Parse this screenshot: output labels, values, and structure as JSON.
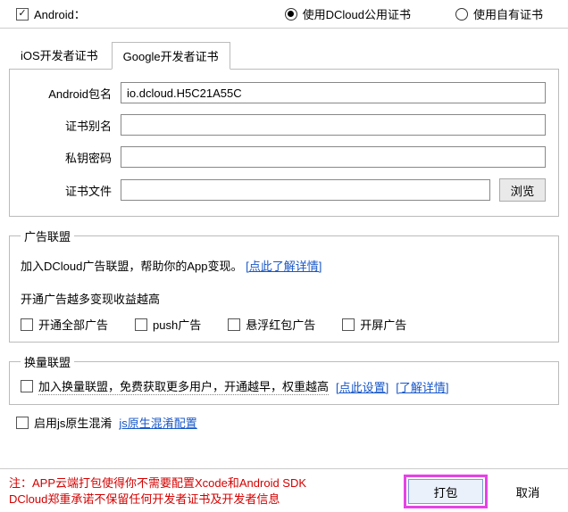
{
  "top": {
    "android_label": "Android：",
    "android_checked": true,
    "cert_public": "使用DCloud公用证书",
    "cert_own": "使用自有证书",
    "cert_selected": "public"
  },
  "tabs": {
    "ios": "iOS开发者证书",
    "google": "Google开发者证书",
    "active": "google"
  },
  "fields": {
    "pkg_label": "Android包名",
    "pkg_value": "io.dcloud.H5C21A55C",
    "alias_label": "证书别名",
    "alias_value": "",
    "pwd_label": "私钥密码",
    "pwd_value": "",
    "cert_label": "证书文件",
    "cert_value": "",
    "browse_btn": "浏览"
  },
  "ads": {
    "title": "广告联盟",
    "intro": "加入DCloud广告联盟，帮助你的App变现。",
    "details_link": "[点此了解详情]",
    "subline": "开通广告越多变现收益越高",
    "opt_all": "开通全部广告",
    "opt_push": "push广告",
    "opt_float": "悬浮红包广告",
    "opt_splash": "开屏广告"
  },
  "exchange": {
    "title": "换量联盟",
    "text": "加入换量联盟，免费获取更多用户，开通越早，权重越高",
    "set_link": "[点此设置]",
    "detail_link": "[了解详情]",
    "checked": false
  },
  "native": {
    "label": "启用js原生混淆",
    "link": "js原生混淆配置",
    "checked": false
  },
  "footer": {
    "note_l1": "注：APP云端打包使得你不需要配置Xcode和Android SDK",
    "note_l2": "DCloud郑重承诺不保留任何开发者证书及开发者信息",
    "build_btn": "打包",
    "cancel_btn": "取消"
  }
}
